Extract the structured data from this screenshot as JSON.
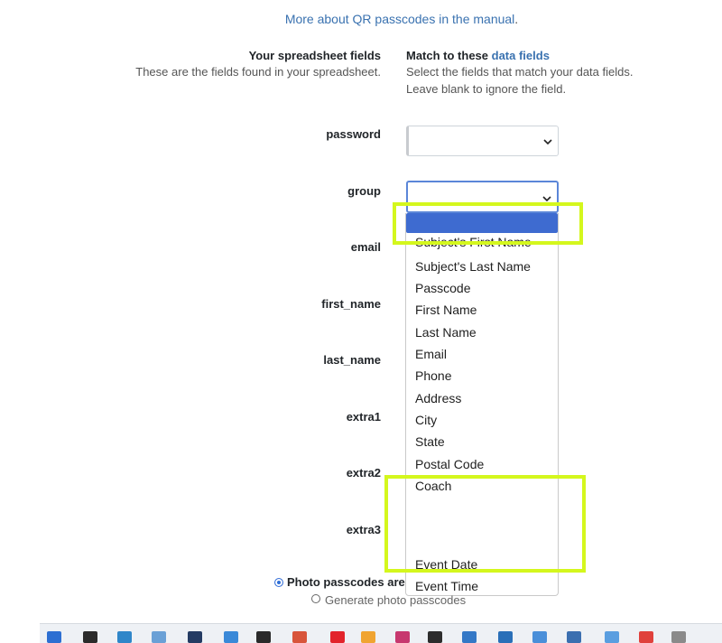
{
  "intro": {
    "link_text": "More about QR passcodes in the manual",
    "suffix": "."
  },
  "left_column": {
    "title": "Your spreadsheet fields",
    "subtitle": "These are the fields found in your spreadsheet."
  },
  "right_column": {
    "title_prefix": "Match to these ",
    "title_link": "data fields",
    "subtitle_line1": "Select the fields that match your data fields.",
    "subtitle_line2": "Leave blank to ignore the field."
  },
  "fields": [
    {
      "label": "password"
    },
    {
      "label": "group"
    },
    {
      "label": "email"
    },
    {
      "label": "first_name"
    },
    {
      "label": "last_name"
    },
    {
      "label": "extra1"
    },
    {
      "label": "extra2"
    },
    {
      "label": "extra3"
    }
  ],
  "dropdown": {
    "selected": "",
    "options": [
      "Subject's First Name",
      "Subject's Last Name",
      "Passcode",
      "First Name",
      "Last Name",
      "Email",
      "Phone",
      "Address",
      "City",
      "State",
      "Postal Code",
      "Coach",
      "Event Date",
      "Event Time"
    ]
  },
  "photo_options": {
    "option1": "Photo passcodes are",
    "option2": "Generate photo passcodes"
  },
  "colors": {
    "link": "#3a72b0",
    "highlight": "#3e6bd0",
    "annotation": "#d4f71d"
  }
}
